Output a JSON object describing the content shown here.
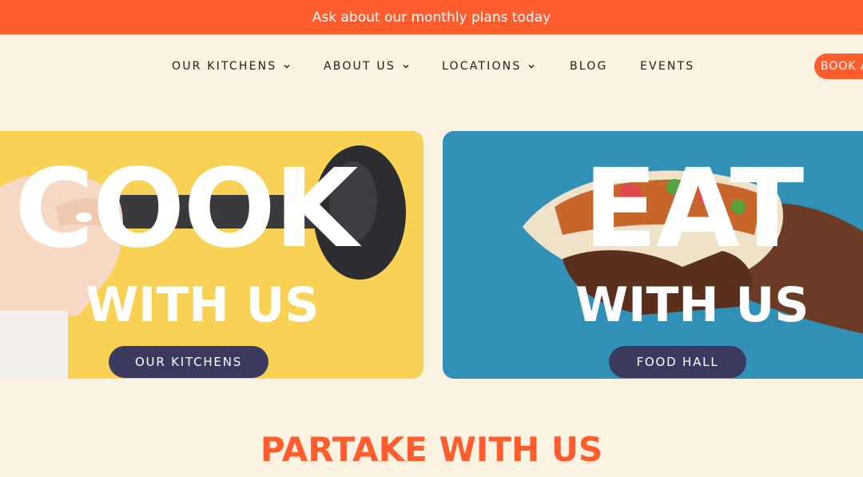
{
  "announcement": "Ask about our monthly plans today",
  "nav": {
    "items": [
      {
        "label": "OUR KITCHENS",
        "has_menu": true
      },
      {
        "label": "ABOUT US",
        "has_menu": true
      },
      {
        "label": "LOCATIONS",
        "has_menu": true
      },
      {
        "label": "BLOG",
        "has_menu": false
      },
      {
        "label": "EVENTS",
        "has_menu": false
      }
    ],
    "book_label": "BOOK A"
  },
  "hero": {
    "cook": {
      "word": "COOK",
      "sub": "WITH US",
      "button": "OUR KITCHENS",
      "bg": "#f8d155"
    },
    "eat": {
      "word": "EAT",
      "sub": "WITH US",
      "button": "FOOD HALL",
      "bg": "#3190b5"
    }
  },
  "section_title": "PARTAKE WITH US",
  "colors": {
    "accent": "#ff5d2e",
    "pill": "#3b3a5e",
    "background": "#fbf2e2"
  }
}
